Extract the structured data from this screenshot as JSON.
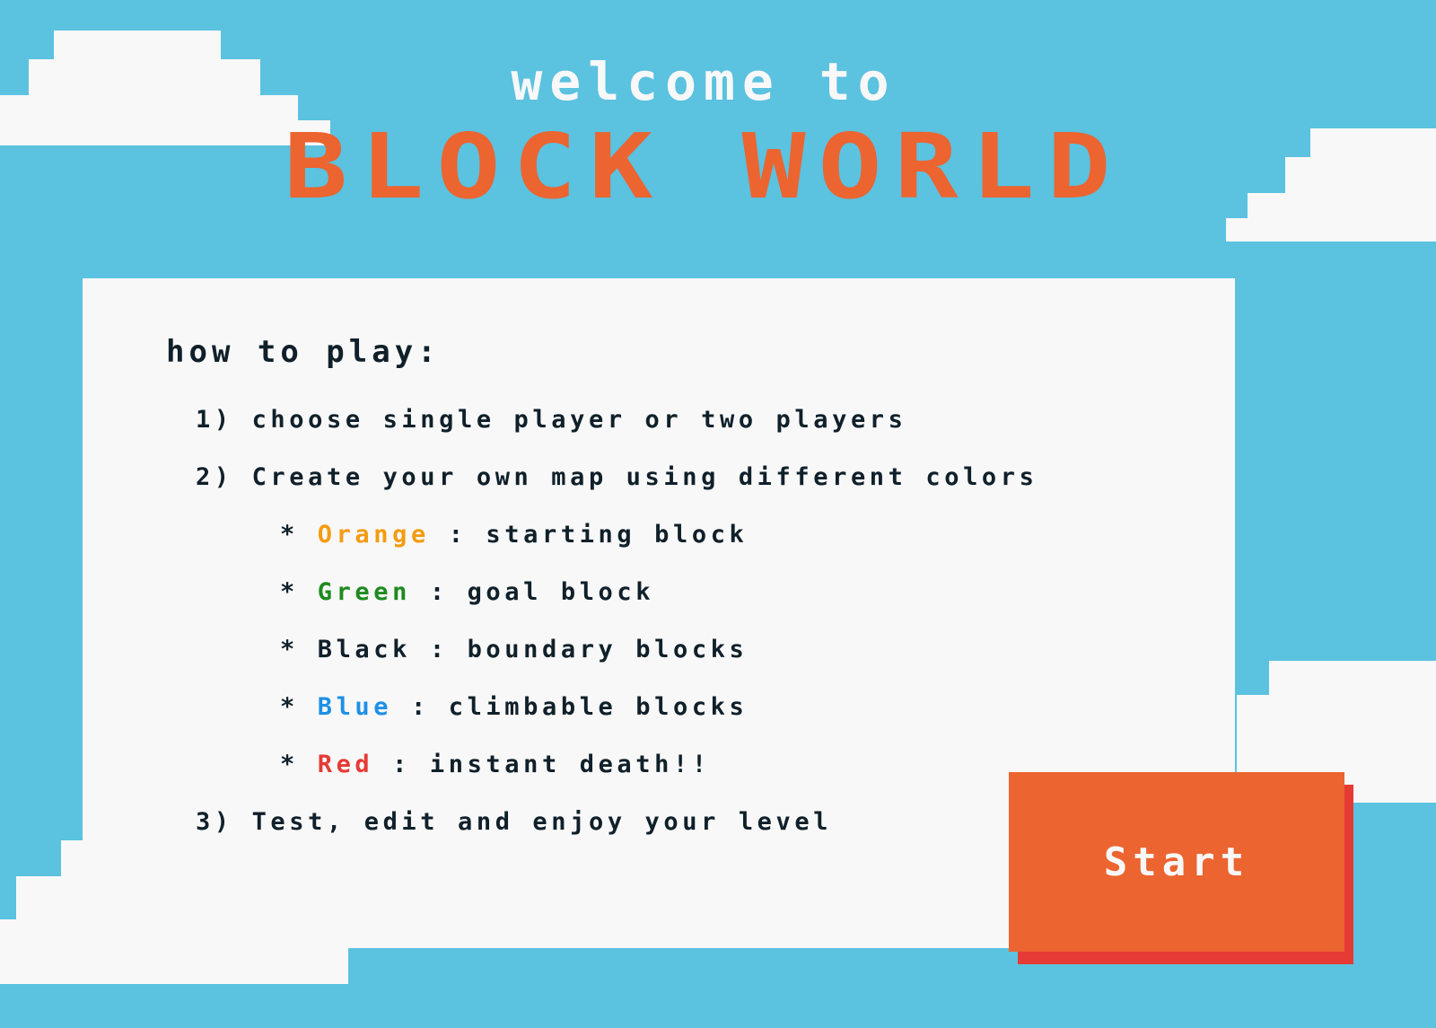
{
  "header": {
    "welcome": "welcome to",
    "title": "BLOCK WORLD"
  },
  "instructions": {
    "heading": "how to play:",
    "steps": [
      {
        "number": "1)",
        "text": "choose single player or two players"
      },
      {
        "number": "2)",
        "text": "Create your own map using different colors"
      },
      {
        "number": "3)",
        "text": "Test, edit and enjoy your level"
      }
    ],
    "legend": [
      {
        "bullet": "*",
        "color_name": "Orange",
        "description": ": starting block",
        "color": "#f39c12"
      },
      {
        "bullet": "*",
        "color_name": "Green",
        "description": ": goal block",
        "color": "#1e8a1e"
      },
      {
        "bullet": "*",
        "color_name": "Black",
        "description": ": boundary blocks",
        "color": "#10202a"
      },
      {
        "bullet": "*",
        "color_name": "Blue",
        "description": ": climbable blocks",
        "color": "#1e90e6"
      },
      {
        "bullet": "*",
        "color_name": "Red",
        "description": ": instant death!!",
        "color": "#e63a35"
      }
    ]
  },
  "start_button": {
    "label": "Start"
  },
  "colors": {
    "sky": "#5bc2e0",
    "cloud": "#f8f8f8",
    "title": "#ec6430",
    "button": "#ec6430",
    "button_shadow": "#e63a35",
    "text": "#10202a"
  }
}
